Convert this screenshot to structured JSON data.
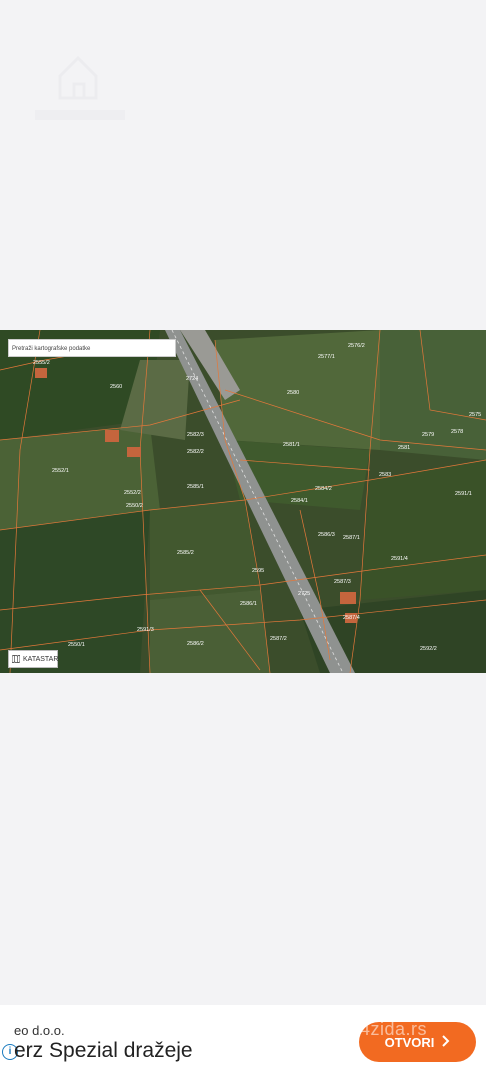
{
  "map": {
    "search_placeholder": "Pretraži kartografske podatke",
    "layer_button": "KATASTAR",
    "parcels": [
      "2555/2",
      "2577/1",
      "2576/2",
      "2560",
      "2724",
      "2580",
      "2575",
      "2582/3",
      "2579",
      "2578",
      "2582/2",
      "2581/1",
      "2581",
      "2583",
      "2552/1",
      "2585/1",
      "2584/2",
      "2591/1",
      "2552/2",
      "2584/1",
      "2550/2",
      "2586/3",
      "2587/1",
      "2585/2",
      "2595",
      "2591/4",
      "2725",
      "2587/3",
      "2586/1",
      "2591/3",
      "2587/4",
      "2586/2",
      "2587/2",
      "2550/1",
      "2592/2"
    ]
  },
  "ad": {
    "company": "eo d.o.o.",
    "title": "erz Spezial dražeje",
    "cta": "OTVORI",
    "watermark": "4zida.rs"
  }
}
